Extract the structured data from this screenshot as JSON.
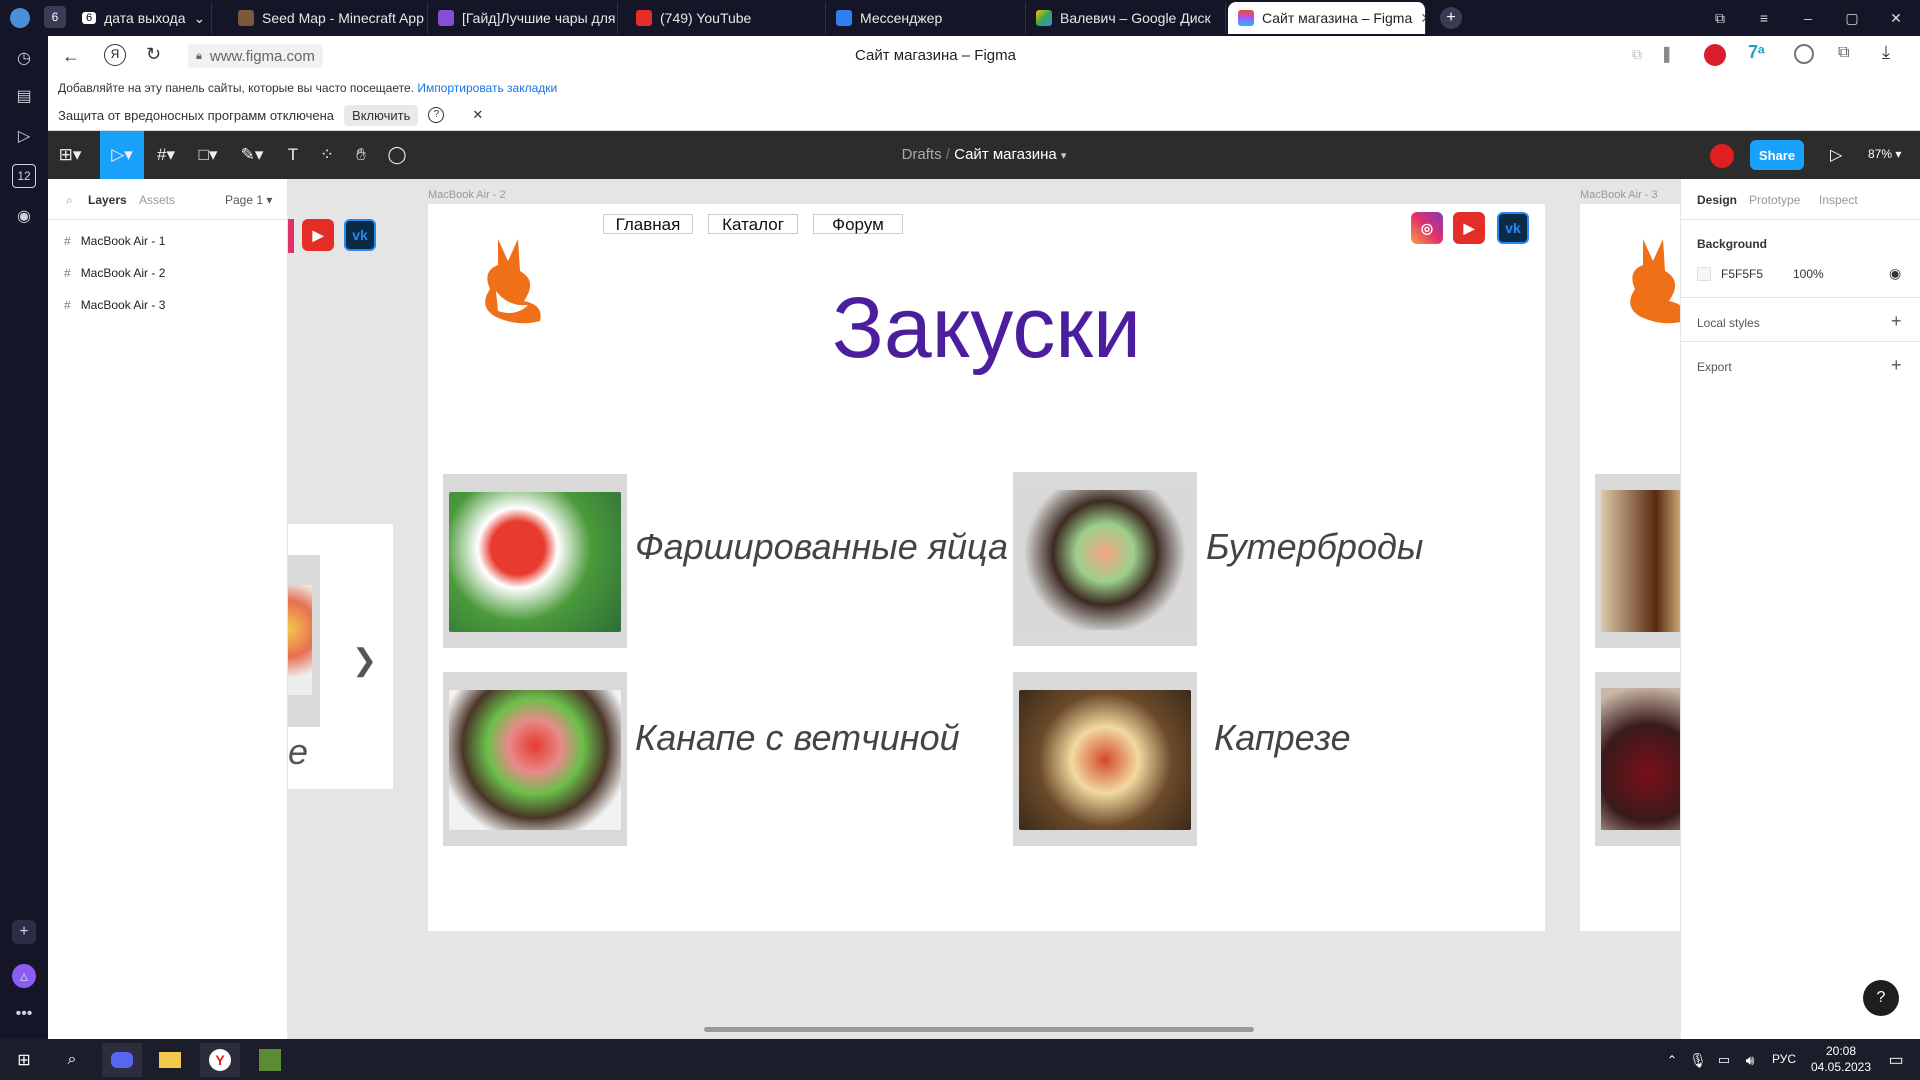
{
  "browser": {
    "tabs": [
      {
        "label": "дата выхода",
        "badge": "6",
        "active": false
      },
      {
        "label": "Seed Map - Minecraft App",
        "active": false
      },
      {
        "label": "[Гайд]Лучшие чары для в...",
        "active": false
      },
      {
        "label": "(749) YouTube",
        "active": false
      },
      {
        "label": "Мессенджер",
        "active": false
      },
      {
        "label": "Валевич – Google Диск",
        "active": false
      },
      {
        "label": "Сайт магазина – Figma",
        "active": true
      }
    ],
    "counter_badge": "6",
    "address": "www.figma.com",
    "page_title": "Сайт магазина – Figma",
    "bookmarks_text": "Добавляйте на эту панель сайты, которые вы часто посещаете.",
    "bookmarks_link": "Импортировать закладки",
    "protection_text": "Защита от вредоносных программ отключена",
    "protection_button": "Включить",
    "sidebar_badge": "12"
  },
  "figma": {
    "breadcrumb_root": "Drafts",
    "file_name": "Сайт магазина",
    "share_label": "Share",
    "zoom": "87%",
    "layers_tab": "Layers",
    "assets_tab": "Assets",
    "page_selector": "Page 1",
    "layers": [
      "MacBook Air - 1",
      "MacBook Air - 2",
      "MacBook Air - 3"
    ],
    "props_tabs": [
      "Design",
      "Prototype",
      "Inspect"
    ],
    "background_label": "Background",
    "bg_hex": "F5F5F5",
    "bg_opacity": "100%",
    "local_styles": "Local styles",
    "export": "Export",
    "help": "?"
  },
  "frames": {
    "label_2": "MacBook Air - 2",
    "label_3": "MacBook Air - 3",
    "nav": [
      "Главная",
      "Каталог",
      "Форум"
    ],
    "heading": "Закуски",
    "heading_color": "#4b1e9e",
    "items": [
      {
        "name": "Фаршированные яйца"
      },
      {
        "name": "Бутерброды"
      },
      {
        "name": "Канапе с ветчиной"
      },
      {
        "name": "Капрезе"
      }
    ],
    "left_partial_text": "е"
  },
  "taskbar": {
    "lang": "РУС",
    "time": "20:08",
    "date": "04.05.2023"
  }
}
